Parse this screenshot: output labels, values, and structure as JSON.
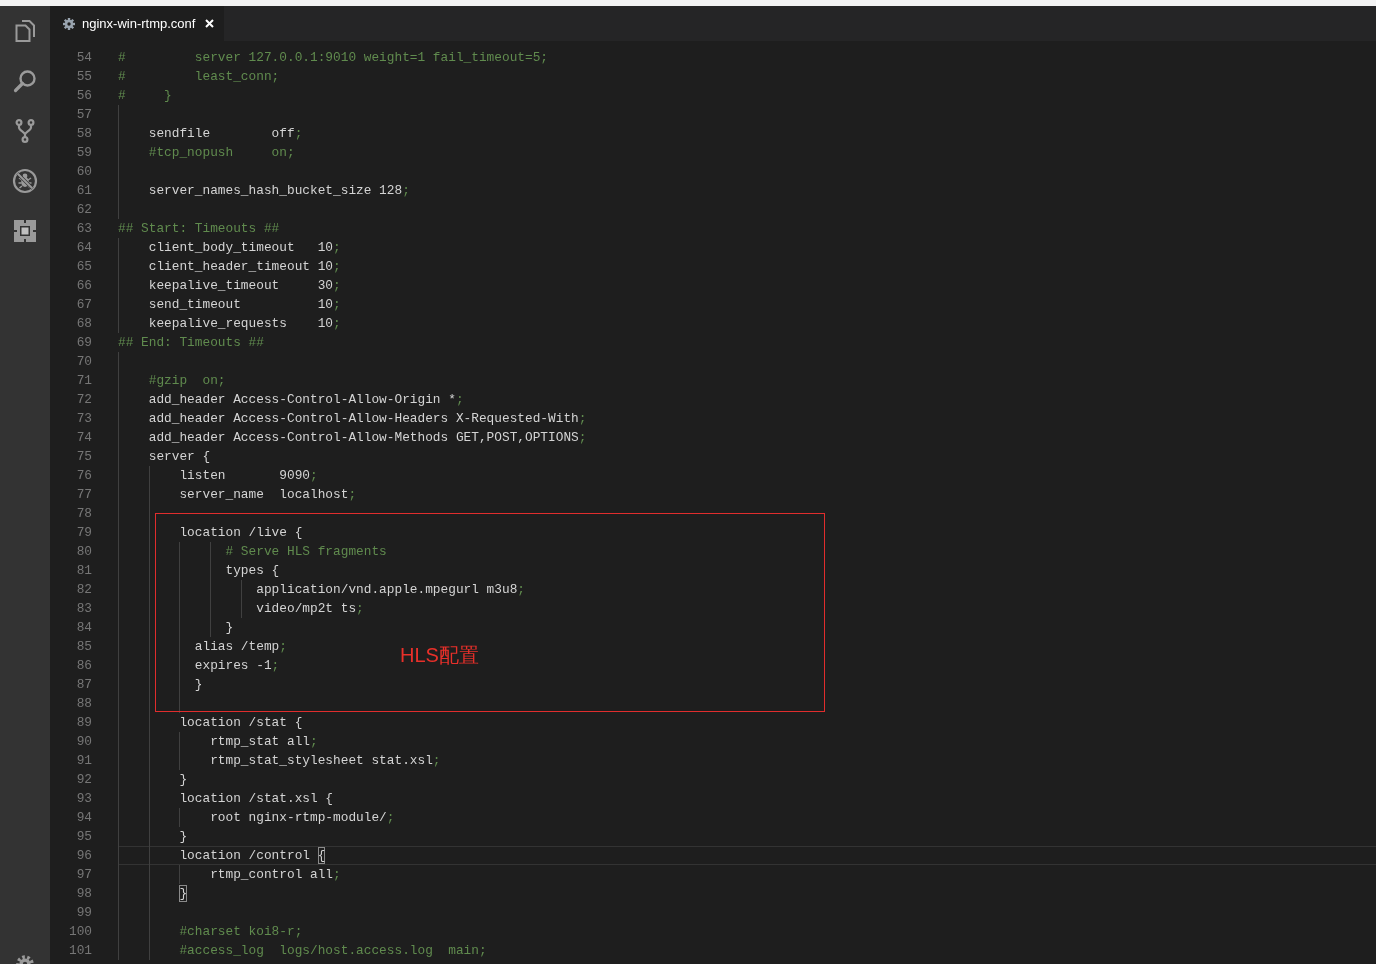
{
  "tabs": [
    {
      "label": "nginx-win-rtmp.conf",
      "selected": true
    }
  ],
  "editor": {
    "lines": [
      {
        "number": "54",
        "current": false,
        "parts": [
          {
            "kind": "comment",
            "text": "#         server 127.0.0.1:9010 weight=1 fail_timeout=5;"
          }
        ]
      },
      {
        "number": "55",
        "current": false,
        "parts": [
          {
            "kind": "comment",
            "text": "#         least_conn;"
          }
        ]
      },
      {
        "number": "56",
        "current": false,
        "parts": [
          {
            "kind": "comment",
            "text": "#     }"
          }
        ]
      },
      {
        "number": "57",
        "current": false
      },
      {
        "number": "58",
        "current": false,
        "parts": [
          {
            "kind": "code",
            "text": "    sendfile        off"
          },
          {
            "kind": "punct",
            "text": ";"
          }
        ]
      },
      {
        "number": "59",
        "current": false,
        "parts": [
          {
            "kind": "comment",
            "text": "    #tcp_nopush     on;"
          }
        ]
      },
      {
        "number": "60",
        "current": false
      },
      {
        "number": "61",
        "current": false,
        "parts": [
          {
            "kind": "code",
            "text": "    server_names_hash_bucket_size 128"
          },
          {
            "kind": "punct",
            "text": ";"
          }
        ]
      },
      {
        "number": "62",
        "current": false
      },
      {
        "number": "63",
        "current": false,
        "parts": [
          {
            "kind": "comment",
            "text": "## Start: Timeouts ##"
          }
        ]
      },
      {
        "number": "64",
        "current": false,
        "parts": [
          {
            "kind": "code",
            "text": "    client_body_timeout   10"
          },
          {
            "kind": "punct",
            "text": ";"
          }
        ]
      },
      {
        "number": "65",
        "current": false,
        "parts": [
          {
            "kind": "code",
            "text": "    client_header_timeout 10"
          },
          {
            "kind": "punct",
            "text": ";"
          }
        ]
      },
      {
        "number": "66",
        "current": false,
        "parts": [
          {
            "kind": "code",
            "text": "    keepalive_timeout     30"
          },
          {
            "kind": "punct",
            "text": ";"
          }
        ]
      },
      {
        "number": "67",
        "current": false,
        "parts": [
          {
            "kind": "code",
            "text": "    send_timeout          10"
          },
          {
            "kind": "punct",
            "text": ";"
          }
        ]
      },
      {
        "number": "68",
        "current": false,
        "parts": [
          {
            "kind": "code",
            "text": "    keepalive_requests    10"
          },
          {
            "kind": "punct",
            "text": ";"
          }
        ]
      },
      {
        "number": "69",
        "current": false,
        "parts": [
          {
            "kind": "comment",
            "text": "## End: Timeouts ##"
          }
        ]
      },
      {
        "number": "70",
        "current": false
      },
      {
        "number": "71",
        "current": false,
        "parts": [
          {
            "kind": "comment",
            "text": "    #gzip  on;"
          }
        ]
      },
      {
        "number": "72",
        "current": false,
        "parts": [
          {
            "kind": "code",
            "text": "    add_header Access-Control-Allow-Origin *"
          },
          {
            "kind": "punct",
            "text": ";"
          }
        ]
      },
      {
        "number": "73",
        "current": false,
        "parts": [
          {
            "kind": "code",
            "text": "    add_header Access-Control-Allow-Headers X-Requested-With"
          },
          {
            "kind": "punct",
            "text": ";"
          }
        ]
      },
      {
        "number": "74",
        "current": false,
        "parts": [
          {
            "kind": "code",
            "text": "    add_header Access-Control-Allow-Methods GET,POST,OPTIONS"
          },
          {
            "kind": "punct",
            "text": ";"
          }
        ]
      },
      {
        "number": "75",
        "current": false,
        "parts": [
          {
            "kind": "code",
            "text": "    server {"
          }
        ]
      },
      {
        "number": "76",
        "current": false,
        "parts": [
          {
            "kind": "code",
            "text": "        listen       9090"
          },
          {
            "kind": "punct",
            "text": ";"
          }
        ]
      },
      {
        "number": "77",
        "current": false,
        "parts": [
          {
            "kind": "code",
            "text": "        server_name  localhost"
          },
          {
            "kind": "punct",
            "text": ";"
          }
        ]
      },
      {
        "number": "78",
        "current": false
      },
      {
        "number": "79",
        "current": false,
        "parts": [
          {
            "kind": "code",
            "text": "        location /live {"
          }
        ]
      },
      {
        "number": "80",
        "current": false,
        "parts": [
          {
            "kind": "comment",
            "text": "              # Serve HLS fragments"
          }
        ]
      },
      {
        "number": "81",
        "current": false,
        "parts": [
          {
            "kind": "code",
            "text": "              types {"
          }
        ]
      },
      {
        "number": "82",
        "current": false,
        "parts": [
          {
            "kind": "code",
            "text": "                  application/vnd.apple.mpegurl m3u8"
          },
          {
            "kind": "punct",
            "text": ";"
          }
        ]
      },
      {
        "number": "83",
        "current": false,
        "parts": [
          {
            "kind": "code",
            "text": "                  video/mp2t ts"
          },
          {
            "kind": "punct",
            "text": ";"
          }
        ]
      },
      {
        "number": "84",
        "current": false,
        "parts": [
          {
            "kind": "code",
            "text": "              }"
          }
        ]
      },
      {
        "number": "85",
        "current": false,
        "parts": [
          {
            "kind": "code",
            "text": "          alias /temp"
          },
          {
            "kind": "punct",
            "text": ";"
          }
        ]
      },
      {
        "number": "86",
        "current": false,
        "parts": [
          {
            "kind": "code",
            "text": "          expires -1"
          },
          {
            "kind": "punct",
            "text": ";"
          }
        ]
      },
      {
        "number": "87",
        "current": false,
        "parts": [
          {
            "kind": "code",
            "text": "          }"
          }
        ]
      },
      {
        "number": "88",
        "current": false
      },
      {
        "number": "89",
        "current": false,
        "parts": [
          {
            "kind": "code",
            "text": "        location /stat {"
          }
        ]
      },
      {
        "number": "90",
        "current": false,
        "parts": [
          {
            "kind": "code",
            "text": "            rtmp_stat all"
          },
          {
            "kind": "punct",
            "text": ";"
          }
        ]
      },
      {
        "number": "91",
        "current": false,
        "parts": [
          {
            "kind": "code",
            "text": "            rtmp_stat_stylesheet stat.xsl"
          },
          {
            "kind": "punct",
            "text": ";"
          }
        ]
      },
      {
        "number": "92",
        "current": false,
        "parts": [
          {
            "kind": "code",
            "text": "        }"
          }
        ]
      },
      {
        "number": "93",
        "current": false,
        "parts": [
          {
            "kind": "code",
            "text": "        location /stat.xsl {"
          }
        ]
      },
      {
        "number": "94",
        "current": false,
        "parts": [
          {
            "kind": "code",
            "text": "            root nginx-rtmp-module/"
          },
          {
            "kind": "punct",
            "text": ";"
          }
        ]
      },
      {
        "number": "95",
        "current": false,
        "parts": [
          {
            "kind": "code",
            "text": "        }"
          }
        ]
      },
      {
        "number": "96",
        "current": true,
        "parts": [
          {
            "kind": "code",
            "text": "        location /control "
          },
          {
            "kind": "bracket",
            "text": "{"
          }
        ]
      },
      {
        "number": "97",
        "current": false,
        "parts": [
          {
            "kind": "code",
            "text": "            rtmp_control all"
          },
          {
            "kind": "punct",
            "text": ";"
          }
        ]
      },
      {
        "number": "98",
        "current": false,
        "parts": [
          {
            "kind": "bracket",
            "text": "        }"
          }
        ]
      },
      {
        "number": "99",
        "current": false
      },
      {
        "number": "100",
        "current": false,
        "parts": [
          {
            "kind": "comment",
            "text": "        #charset koi8-r;"
          }
        ]
      },
      {
        "number": "101",
        "current": false,
        "parts": [
          {
            "kind": "comment",
            "text": "        #access_log  logs/host.access.log  main;"
          }
        ]
      }
    ],
    "annotation": {
      "label": "HLS配置"
    }
  }
}
